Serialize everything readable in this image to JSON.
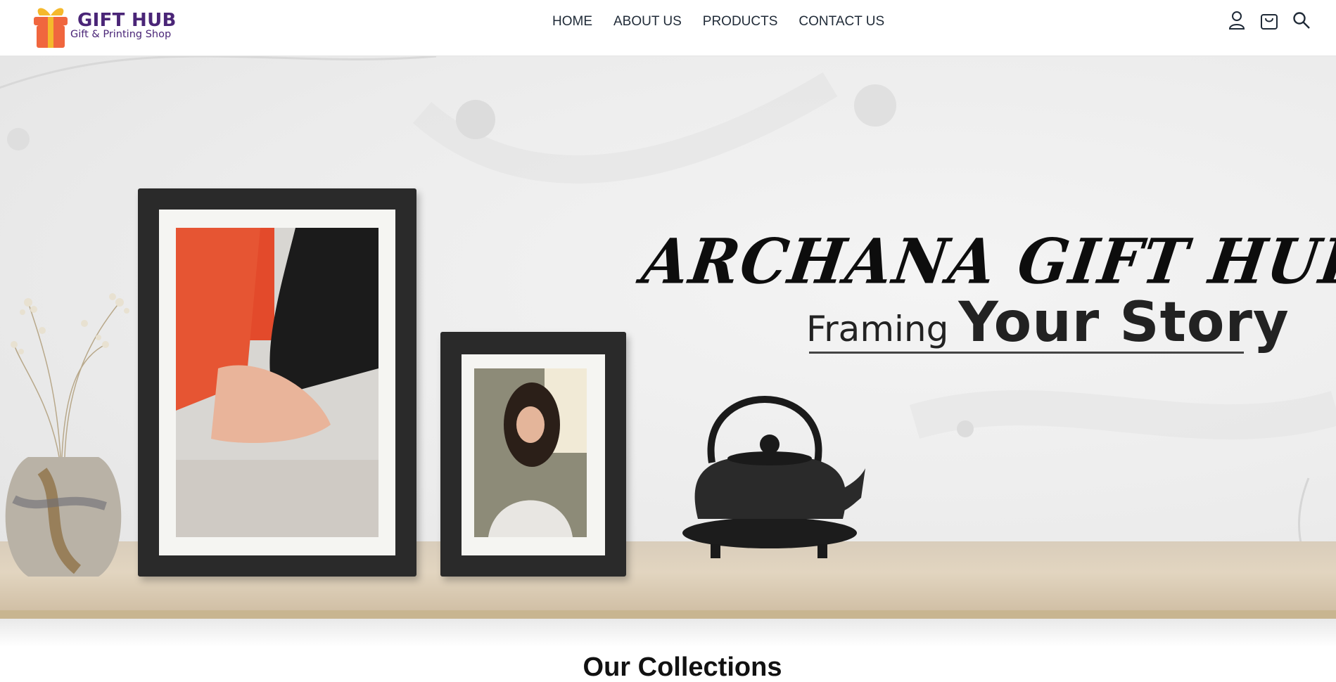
{
  "brand": {
    "name": "GIFT HUB",
    "tagline": "Gift & Printing Shop",
    "colors": {
      "primary": "#4a2577",
      "gift_box": "#f0663e",
      "ribbon": "#f5b92c"
    }
  },
  "nav": {
    "items": [
      {
        "label": "HOME"
      },
      {
        "label": "ABOUT US"
      },
      {
        "label": "PRODUCTS"
      },
      {
        "label": "CONTACT US"
      }
    ]
  },
  "header_icons": [
    "user-icon",
    "shopping-bag-icon",
    "search-icon"
  ],
  "hero": {
    "title": "ARCHANA GIFT HUB",
    "subtitle_small": "Framing",
    "subtitle_big": "Your Story"
  },
  "collections": {
    "title": "Our Collections"
  }
}
